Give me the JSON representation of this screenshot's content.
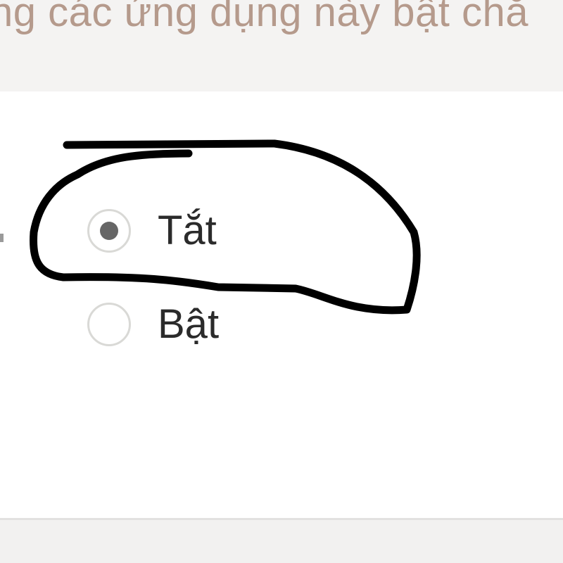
{
  "header": {
    "description_text": "ng các ứng dụng này bật chă"
  },
  "setting": {
    "options": [
      {
        "label": "Tắt",
        "selected": true
      },
      {
        "label": "Bật",
        "selected": false
      }
    ]
  },
  "colors": {
    "description_text": "#b59a8c",
    "panel_background": "#ffffff",
    "page_background": "#f3f2f1",
    "selected_dot": "#666666",
    "annotation_stroke": "#000000"
  },
  "annotation": {
    "type": "hand-drawn circle",
    "marks_option": "Tắt"
  }
}
